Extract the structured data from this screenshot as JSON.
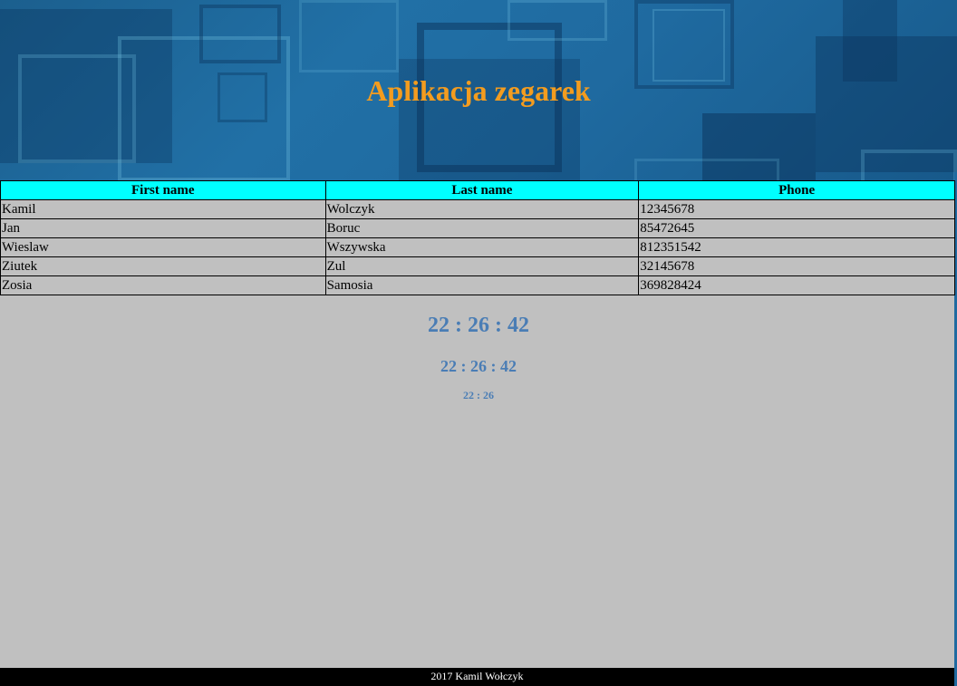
{
  "header": {
    "title": "Aplikacja zegarek",
    "title_color": "#f39c1f",
    "background_color": "#1f6aa0"
  },
  "table": {
    "header_color": "#00ffff",
    "columns": [
      "First name",
      "Last name",
      "Phone"
    ],
    "rows": [
      [
        "Kamil",
        "Wolczyk",
        "12345678"
      ],
      [
        "Jan",
        "Boruc",
        "85472645"
      ],
      [
        "Wieslaw",
        "Wszywska",
        "812351542"
      ],
      [
        "Ziutek",
        "Zul",
        "32145678"
      ],
      [
        "Zosia",
        "Samosia",
        "369828424"
      ]
    ]
  },
  "clocks": {
    "color": "#4a7db5",
    "large": "22 : 26 : 42",
    "medium": "22 : 26 : 42",
    "small": "22 : 26"
  },
  "footer": {
    "text": "2017 Kamil Wołczyk"
  }
}
